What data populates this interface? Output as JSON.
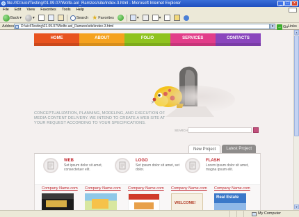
{
  "window": {
    "title": "file:///D:/uicl/Testing/01.09.07/Wolfe-aol_Ramzes/site/index-3.html - Microsoft Internet Explorer",
    "controls": [
      "_",
      "□",
      "×"
    ]
  },
  "menu": [
    "File",
    "Edit",
    "View",
    "Favorites",
    "Tools",
    "Help"
  ],
  "toolbar": {
    "back_label": "Back",
    "search_label": "Search",
    "favorites_label": "Favorites"
  },
  "address": {
    "label": "Address",
    "url": "D:\\uicl\\Testing\\01.09.07\\Wolfe-aol_Ramzes\\site\\index-3.html",
    "go_label": "Go",
    "links_label": "Links"
  },
  "site": {
    "nav": [
      {
        "label": "HOME",
        "color": "#e8531f"
      },
      {
        "label": "ABOUT",
        "color": "#f5a21f"
      },
      {
        "label": "FOLIO",
        "color": "#8fc31f"
      },
      {
        "label": "SERVICES",
        "color": "#e23d8a"
      },
      {
        "label": "CONTACTS",
        "color": "#8a45bd"
      }
    ],
    "tagline": "CONCEPTUALIZATION, PLANNING, MODELING, AND EXECUTION OF MEDIA CONTENT DELIVERY. WE INTEND TO CREATE A WEB SITE AT YOUR REQUEST ACCORDING TO YOUR SPECIFICATIONS.",
    "search_label": "SEARCH",
    "tabs": [
      "New Project",
      "Latest Project"
    ],
    "services": [
      {
        "title": "WEB",
        "desc": "Set ipsum dolor sit amet, consectetuer elit."
      },
      {
        "title": "LOGO",
        "desc": "Set ipsum dolor sit amet, set dolor."
      },
      {
        "title": "FLASH",
        "desc": "Lorem ipsum dolor sit amet, magna ipsum elit."
      }
    ],
    "companies": [
      "Company Name.com",
      "Company Name.com",
      "Company Name.com",
      "Company Name.com",
      "Company Name.com"
    ],
    "thumbs": [
      {
        "caption": ""
      },
      {
        "caption": ""
      },
      {
        "caption": ""
      },
      {
        "caption": "WELCOME!"
      },
      {
        "caption": "Real Estate"
      }
    ]
  },
  "status": {
    "zone": "My Computer"
  }
}
